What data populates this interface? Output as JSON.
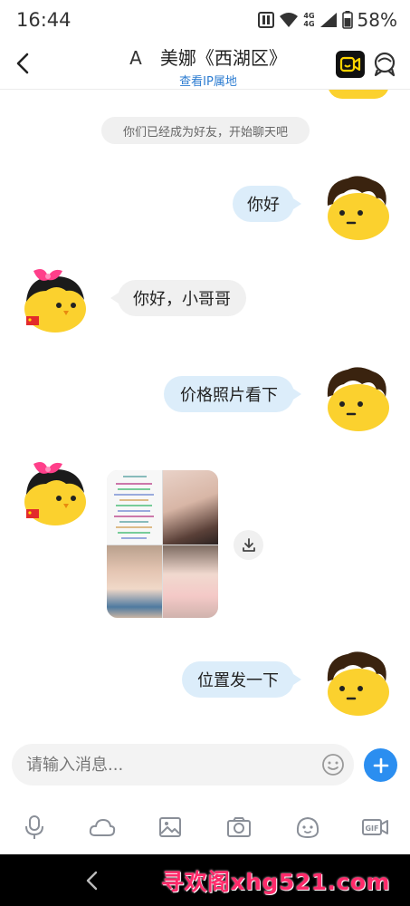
{
  "status_bar": {
    "time": "16:44",
    "network_1": "4G",
    "network_2": "4G",
    "battery": "58%"
  },
  "header": {
    "prefix": "A",
    "title": "美娜《西湖区》",
    "ip_link": "查看IP属地",
    "icons": [
      "back-icon",
      "video-call-icon",
      "profile-icon"
    ]
  },
  "chat": {
    "system_notice": "你们已经成为好友，开始聊天吧",
    "messages": [
      {
        "from": "me",
        "text": "你好"
      },
      {
        "from": "them",
        "text": "你好，小哥哥"
      },
      {
        "from": "me",
        "text": "价格照片看下"
      },
      {
        "from": "them",
        "type": "image"
      },
      {
        "from": "me",
        "text": "位置发一下"
      }
    ]
  },
  "composer": {
    "placeholder": "请输入消息...",
    "value": ""
  },
  "toolbar": {
    "items": [
      "mic-icon",
      "cloud-icon",
      "image-icon",
      "camera-icon",
      "sticker-icon",
      "gif-icon"
    ],
    "gif_label": "GIF"
  },
  "watermark": "寻欢阁xhg521.com",
  "colors": {
    "accent_blue": "#2b8ef0",
    "outgoing_bubble": "#dcedfa",
    "incoming_bubble": "#f0f0f0",
    "avatar_yellow": "#fbd12e",
    "watermark": "#ff2a6a"
  }
}
